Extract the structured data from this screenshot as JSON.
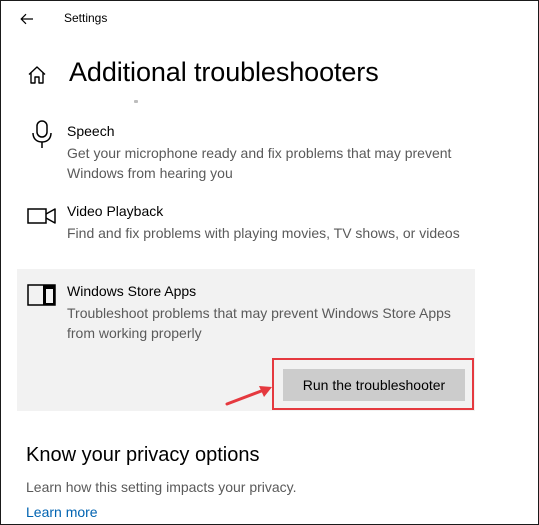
{
  "window": {
    "app_title": "Settings"
  },
  "header": {
    "page_title": "Additional troubleshooters"
  },
  "troubleshooters": [
    {
      "icon": "microphone-icon",
      "title": "Speech",
      "description": "Get your microphone ready and fix problems that may prevent Windows from hearing you"
    },
    {
      "icon": "video-camera-icon",
      "title": "Video Playback",
      "description": "Find and fix problems with playing movies, TV shows, or videos"
    },
    {
      "icon": "store-apps-icon",
      "title": "Windows Store Apps",
      "description": "Troubleshoot problems that may prevent Windows Store Apps from working properly",
      "selected": true,
      "action_label": "Run the troubleshooter"
    }
  ],
  "privacy": {
    "heading": "Know your privacy options",
    "description": "Learn how this setting impacts your privacy.",
    "link_label": "Learn more"
  },
  "colors": {
    "accent_link": "#0063b1",
    "selected_bg": "#f2f2f2",
    "button_bg": "#cccccc",
    "annotation_red": "#e5393f",
    "secondary_text": "#5a5a5a"
  }
}
